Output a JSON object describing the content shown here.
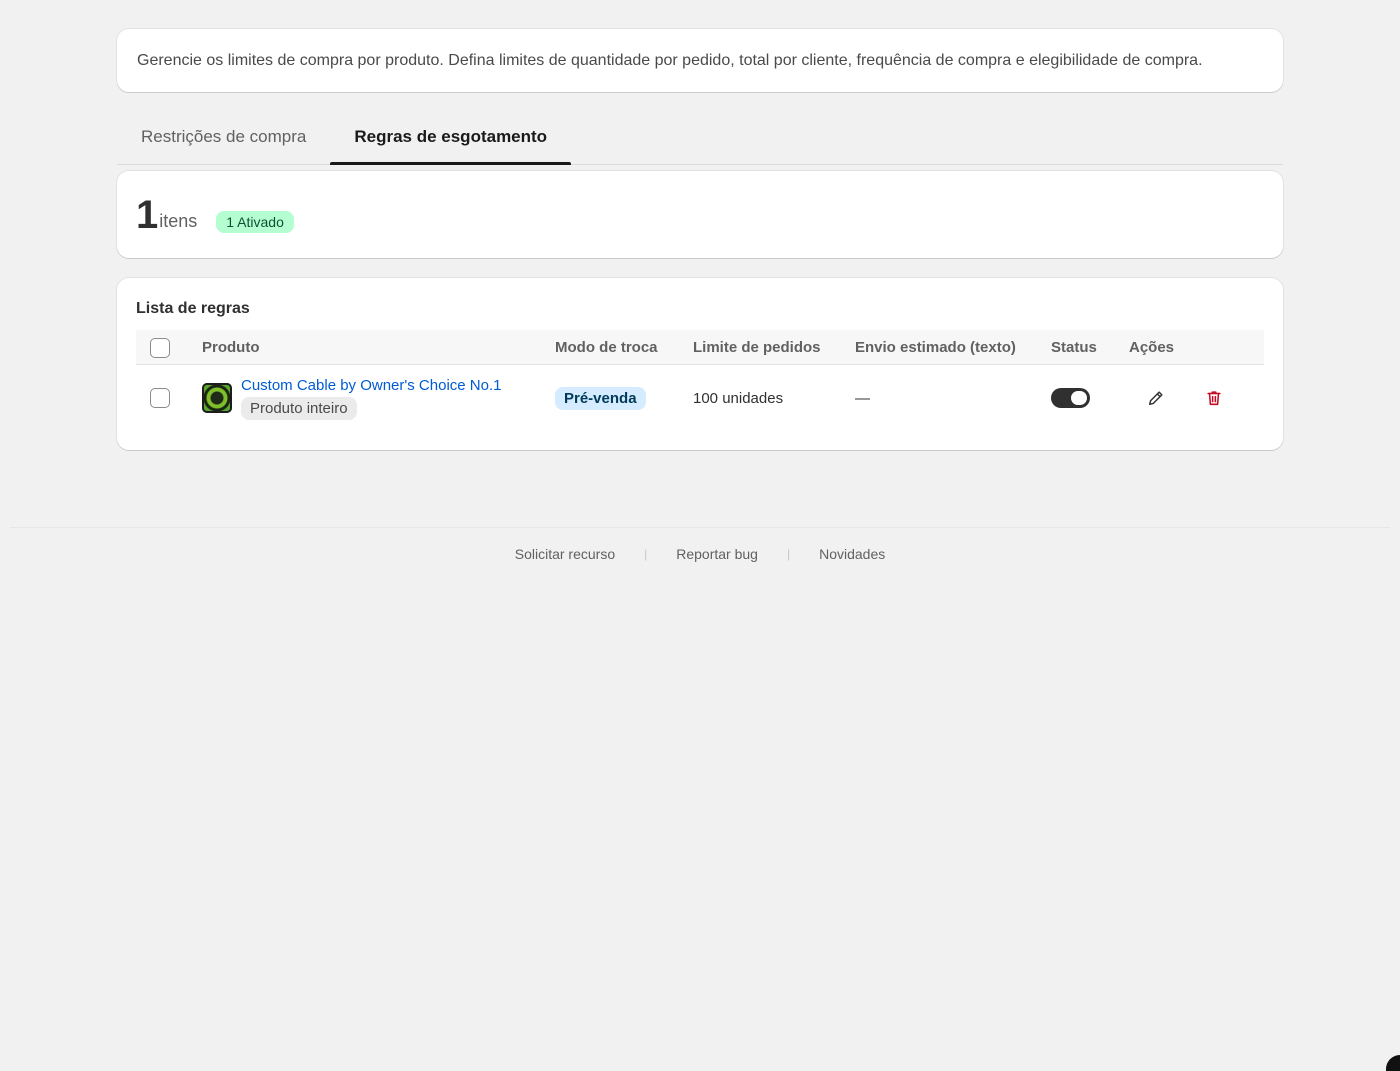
{
  "description": "Gerencie os limites de compra por produto. Defina limites de quantidade por pedido, total por cliente, frequência de compra e elegibilidade de compra.",
  "tabs": [
    {
      "label": "Restrições de compra",
      "active": false
    },
    {
      "label": "Regras de esgotamento",
      "active": true
    }
  ],
  "summary": {
    "count": "1",
    "count_label": "itens",
    "active_badge": "1 Ativado"
  },
  "rules": {
    "title": "Lista de regras",
    "columns": {
      "product": "Produto",
      "mode": "Modo de troca",
      "limit": "Limite de pedidos",
      "shipping": "Envio estimado (texto)",
      "status": "Status",
      "actions": "Ações"
    },
    "rows": [
      {
        "product_name": "Custom Cable by Owner's Choice No.1",
        "product_scope": "Produto inteiro",
        "mode": "Pré-venda",
        "limit": "100 unidades",
        "shipping": "—",
        "status_enabled": true
      }
    ]
  },
  "footer": {
    "links": [
      "Solicitar recurso",
      "Reportar bug",
      "Novidades"
    ],
    "separator": "|"
  },
  "colors": {
    "background": "#f1f1f1",
    "link": "#005bd3",
    "active_badge_bg": "#b4fed2",
    "mode_badge_bg": "#d5ebff",
    "delete_red": "#c70a24",
    "toggle_on": "#303030"
  },
  "icons": {
    "edit": "pencil-icon",
    "delete": "trash-icon",
    "product_thumbnail": "product-thumbnail"
  }
}
